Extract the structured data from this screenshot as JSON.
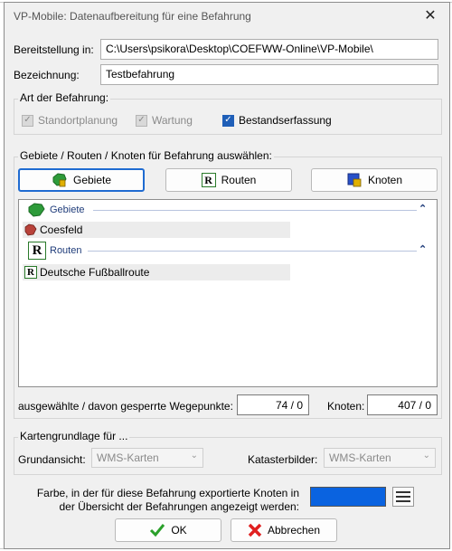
{
  "window": {
    "title": "VP-Mobile: Datenaufbereitung für eine Befahrung",
    "close_glyph": "✕"
  },
  "form": {
    "bereitstellung_label": "Bereitstellung in:",
    "bereitstellung_value": "C:\\Users\\psikora\\Desktop\\COEFWW-Online\\VP-Mobile\\",
    "bezeichnung_label": "Bezeichnung:",
    "bezeichnung_value": "Testbefahrung"
  },
  "art": {
    "label": "Art der Befahrung:",
    "options": [
      {
        "label": "Standortplanung",
        "checked": true,
        "enabled": false
      },
      {
        "label": "Wartung",
        "checked": true,
        "enabled": false
      },
      {
        "label": "Bestandserfassung",
        "checked": true,
        "enabled": true
      }
    ]
  },
  "auswahl": {
    "label": "Gebiete / Routen / Knoten für Befahrung auswählen:",
    "buttons": [
      {
        "label": "Gebiete",
        "icon": "gebiete-icon",
        "active": true
      },
      {
        "label": "Routen",
        "icon": "routen-icon",
        "active": false
      },
      {
        "label": "Knoten",
        "icon": "knoten-icon",
        "active": false
      }
    ],
    "sections": [
      {
        "title": "Gebiete",
        "items": [
          "Coesfeld"
        ]
      },
      {
        "title": "Routen",
        "items": [
          "Deutsche Fußballroute"
        ]
      }
    ],
    "wegepunkte_label": "ausgewählte / davon gesperrte Wegepunkte:",
    "wegepunkte_value": "74 / 0",
    "knoten_label": "Knoten:",
    "knoten_value": "407 / 0"
  },
  "karten": {
    "label": "Kartengrundlage für ...",
    "grundansicht_label": "Grundansicht:",
    "grundansicht_value": "WMS-Karten",
    "kataster_label": "Katasterbilder:",
    "kataster_value": "WMS-Karten"
  },
  "farbe": {
    "text_line1": "Farbe, in der für diese Befahrung exportierte Knoten in",
    "text_line2": "der Übersicht der Befahrungen angezeigt werden:",
    "color": "#0a63e0"
  },
  "actions": {
    "ok_label": "OK",
    "cancel_label": "Abbrechen"
  }
}
